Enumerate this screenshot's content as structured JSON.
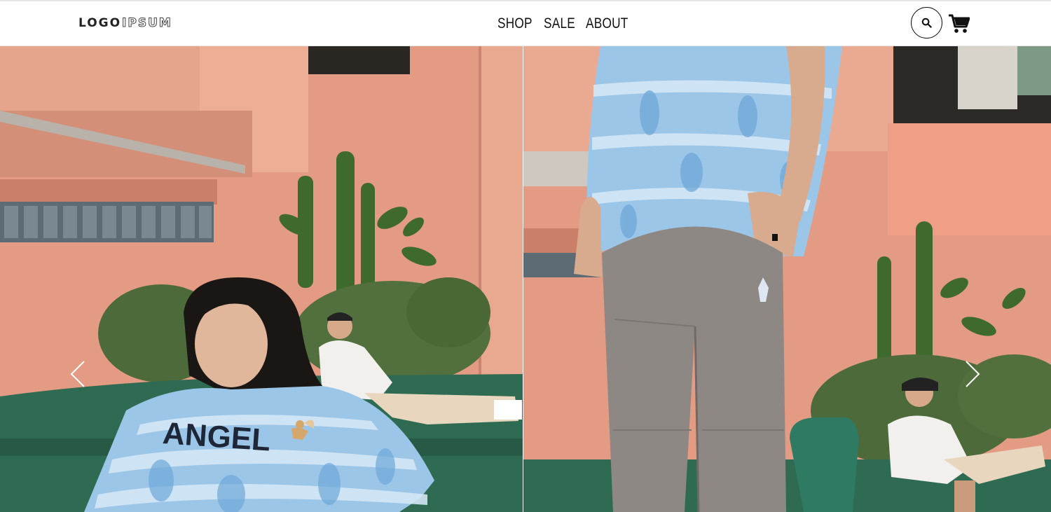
{
  "header": {
    "logo": {
      "part1": "LOGO",
      "part2": "IPSUM"
    },
    "nav": [
      {
        "label": "SHOP"
      },
      {
        "label": "SALE"
      },
      {
        "label": "ABOUT"
      }
    ],
    "search_icon": "search-icon",
    "cart_icon": "cart-icon"
  },
  "hero": {
    "left_image": {
      "shirt_text": "ANGEL"
    },
    "prev_icon": "chevron-left-icon",
    "next_icon": "chevron-right-icon"
  },
  "colors": {
    "wall": "#e39b83",
    "bench": "#2f6b52",
    "tiedye": "#9cc6e8",
    "pants": "#8e8884"
  }
}
